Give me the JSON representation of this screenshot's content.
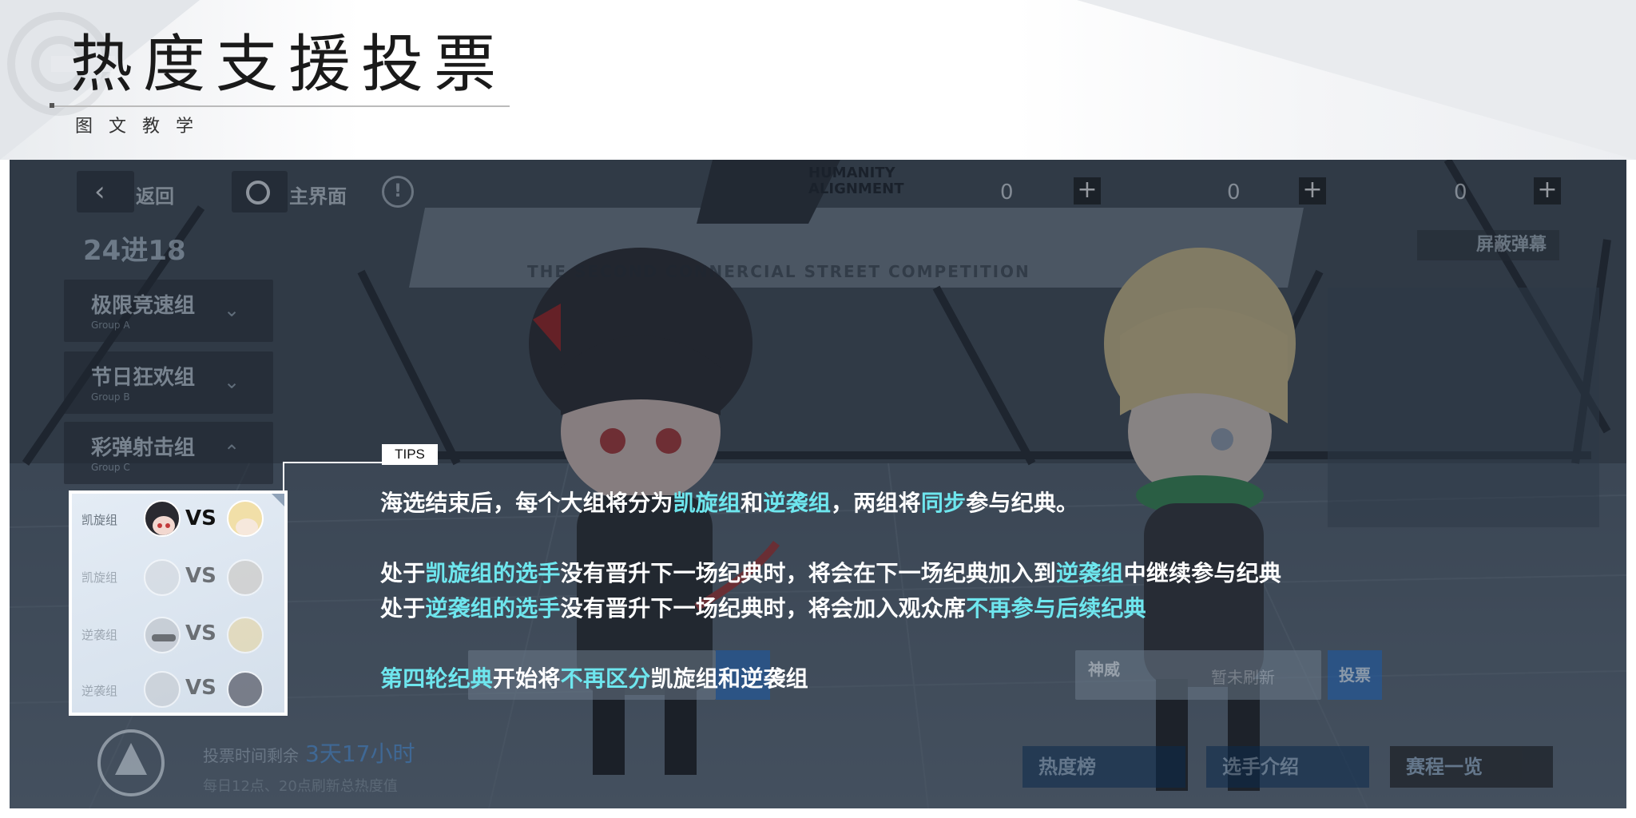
{
  "header": {
    "title": "热度支援投票",
    "subtitle": "图文教学"
  },
  "topbar": {
    "back_label": "返回",
    "home_label": "主界面",
    "info_icon": "info-circle-icon",
    "brand_lines": [
      "HUMANITY",
      "ALIGNMENT"
    ],
    "counters": [
      "0",
      "0",
      "0"
    ],
    "plus_label": "+"
  },
  "stage_title": "24进18",
  "mute_label": "屏蔽弹幕",
  "banner_text": "THE SECOND CONNERCIAL STREET COMPETITION",
  "groups": [
    {
      "name": "极限竞速组",
      "sub": "Group A"
    },
    {
      "name": "节日狂欢组",
      "sub": "Group B"
    },
    {
      "name": "彩弹射击组",
      "sub": "Group C"
    }
  ],
  "matches": [
    {
      "label": "凯旋组",
      "vs": "VS"
    },
    {
      "label": "凯旋组",
      "vs": "VS"
    },
    {
      "label": "逆袭组",
      "vs": "VS"
    },
    {
      "label": "逆袭组",
      "vs": "VS"
    }
  ],
  "vote_panels": [
    {
      "name": "",
      "status": ""
    },
    {
      "name": "神威",
      "status": "暂未刷新",
      "button": "投票"
    }
  ],
  "timer": {
    "label": "投票时间剩余",
    "value": "3天17小时",
    "note": "每日12点、20点刷新总热度值"
  },
  "bottom_buttons": [
    "热度榜",
    "选手介绍",
    "赛程一览"
  ],
  "tips": {
    "tag": "TIPS",
    "line1": [
      "海选结束后，每个大组将分为",
      "凯旋组",
      "和",
      "逆袭组",
      "，两组将",
      "同步",
      "参与纪典。"
    ],
    "line2": [
      "处于",
      "凯旋组的选手",
      "没有晋升下一场纪典时，将会在下一场纪典加入到",
      "逆袭组",
      "中继续参与纪典"
    ],
    "line3": [
      "处于",
      "逆袭组的选手",
      "没有晋升下一场纪典时，将会加入观众席",
      "不再参与后续纪典"
    ],
    "line4": [
      "第四轮纪典",
      "开始将",
      "不再区分",
      "凯旋组和逆袭组"
    ]
  },
  "colors": {
    "highlight": "#6ee6ee",
    "tip_text": "#ffffff",
    "timer_blue": "#3d7fc4",
    "vote_blue": "#1b5aa8"
  }
}
